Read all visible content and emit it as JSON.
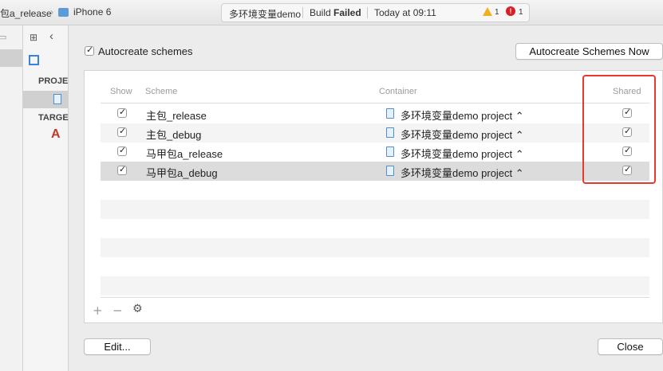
{
  "toolbar": {
    "scheme_name": "包a_release",
    "device": "iPhone 6",
    "project": "多环境变量demo",
    "build_label": "Build",
    "build_status": "Failed",
    "time": "Today at 09:11",
    "warning_count": "1",
    "error_count": "1"
  },
  "navigator": {
    "project_header": "PROJE",
    "targets_header": "TARGE"
  },
  "sheet": {
    "autocreate_label": "Autocreate schemes",
    "autocreate_now_button": "Autocreate Schemes Now",
    "columns": {
      "show": "Show",
      "scheme": "Scheme",
      "container": "Container",
      "shared": "Shared"
    },
    "rows": [
      {
        "scheme": "主包_release",
        "container": "多环境变量demo project ⌃",
        "show": true,
        "shared": true
      },
      {
        "scheme": "主包_debug",
        "container": "多环境变量demo project ⌃",
        "show": true,
        "shared": true
      },
      {
        "scheme": "马甲包a_release",
        "container": "多环境变量demo project ⌃",
        "show": true,
        "shared": true
      },
      {
        "scheme": "马甲包a_debug",
        "container": "多环境变量demo project ⌃",
        "show": true,
        "shared": true
      }
    ],
    "edit_button": "Edit...",
    "close_button": "Close",
    "add_symbol": "+",
    "remove_symbol": "−"
  },
  "colors": {
    "highlight": "#e8392f",
    "selected_row": "#dcdcdc",
    "warning": "#f2b01e",
    "error": "#d91f26"
  }
}
